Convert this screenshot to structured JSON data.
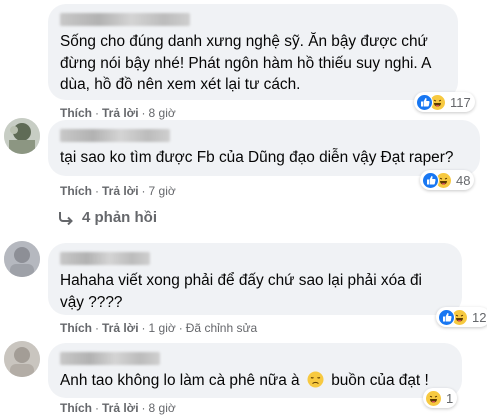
{
  "comments": [
    {
      "text": "Sống cho đúng danh xưng nghệ sỹ. Ăn bậy được chứ đừng nói bậy nhé! Phát ngôn hàm hồ thiếu suy nghi. A dùa, hồ đồ nên xem xét lại tư cách.",
      "like": "Thích",
      "reply": "Trả lời",
      "time": "8 giờ",
      "reaction_count": "117"
    },
    {
      "text": "tại sao ko tìm được Fb của Dũng đạo diễn vậy Đạt raper?",
      "like": "Thích",
      "reply": "Trả lời",
      "time": "7 giờ",
      "reaction_count": "48"
    },
    {
      "text": "Hahaha viết xong phải để đấy chứ sao lại phải xóa đi vậy ????",
      "like": "Thích",
      "reply": "Trả lời",
      "time": "1 giờ",
      "edited": "Đã chỉnh sửa",
      "reaction_count": "12"
    },
    {
      "text_before": "Anh tao không lo làm cà phê nữa à",
      "text_after": "buồn của đạt !",
      "like": "Thích",
      "reply": "Trả lời",
      "time": "8 giờ",
      "reaction_count": "1"
    }
  ],
  "replies_link": "4 phản hồi",
  "colors": {
    "bubble": "#f0f2f5",
    "meta": "#65676b",
    "like_blue": "#1877f2",
    "haha_yellow": "#f7c940"
  }
}
